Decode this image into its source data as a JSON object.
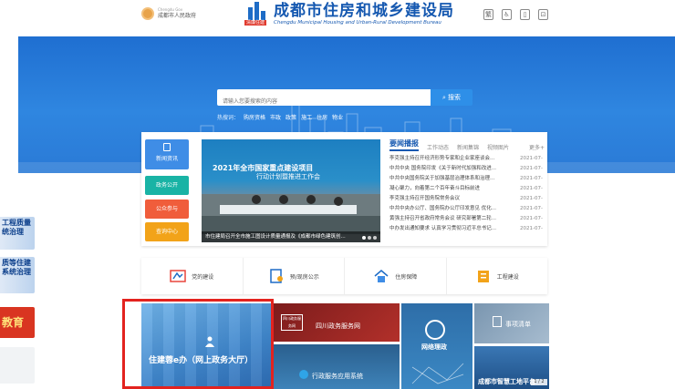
{
  "header": {
    "gov_logo_en": "Chengdu Gov",
    "gov_logo_cn": "成都市人民政府",
    "logo_tag": "清廉住建",
    "title": "成都市住房和城乡建设局",
    "subtitle": "Chengdu Municipal Housing and Urban-Rural Development Bureau",
    "tools": [
      {
        "icon": "traditional-chinese-icon",
        "glyph": "繁"
      },
      {
        "icon": "accessibility-icon",
        "glyph": "♿"
      },
      {
        "icon": "mobile-icon",
        "glyph": "▯"
      },
      {
        "icon": "wechat-icon",
        "glyph": "⊡"
      }
    ]
  },
  "search": {
    "placeholder": "请输入您要搜索的内容",
    "button_label": "搜索",
    "hot_label": "热搜词：",
    "hot_words": [
      "购房资格",
      "市政",
      "政策",
      "施工",
      "住房",
      "物业"
    ]
  },
  "side_promos": [
    {
      "text": "工程质量\n统治理"
    },
    {
      "text": "质等住建\n系统治理"
    },
    {
      "text": "教育"
    },
    {
      "text": ""
    }
  ],
  "quick_nav": [
    {
      "label": "新闻资讯",
      "color": "#3f8de6"
    },
    {
      "label": "政务公开",
      "color": "#19b3a5"
    },
    {
      "label": "公众参与",
      "color": "#f05d3b"
    },
    {
      "label": "查询中心",
      "color": "#f2a319"
    }
  ],
  "carousel": {
    "banner_line1": "2021年全市国家重点建设项目",
    "banner_line2": "行动计划暨推进工作会",
    "caption": "市住建局召开全市施工图设计质量通报及《成都市绿色建筑创..."
  },
  "news": {
    "tabs": [
      {
        "label": "要闻播报",
        "active": true
      },
      {
        "label": "工作动态",
        "active": false
      },
      {
        "label": "新闻集锦",
        "active": false
      },
      {
        "label": "视频图片",
        "active": false
      }
    ],
    "more": "更多+",
    "items": [
      {
        "title": "李克强主持召开经济形势专家和企业家座谈会...",
        "date": "2021-07-"
      },
      {
        "title": "中共中央 国务院印发《关于新时代加强和改进...",
        "date": "2021-07-"
      },
      {
        "title": "中共中央国务院关于加强基层治理体系和治理...",
        "date": "2021-07-"
      },
      {
        "title": "凝心聚力，向着第二个百年奋斗目标前进",
        "date": "2021-07-"
      },
      {
        "title": "李克强主持召开国务院常务会议",
        "date": "2021-07-"
      },
      {
        "title": "中共中央办公厅、国务院办公厅印发意见 优化...",
        "date": "2021-07-"
      },
      {
        "title": "黄强主持召开省政府常务会议 研究部署第二轮...",
        "date": "2021-07-"
      },
      {
        "title": "中办发出通知要求 认真学习贯彻习近平总书记...",
        "date": "2021-07-"
      }
    ]
  },
  "services": [
    {
      "label": "党的建设",
      "icon": "party-building-icon"
    },
    {
      "label": "预/现房公示",
      "icon": "house-notice-icon"
    },
    {
      "label": "住房保障",
      "icon": "housing-security-icon"
    },
    {
      "label": "工程建设",
      "icon": "construction-icon"
    }
  ],
  "tiles": {
    "main": "住建蓉e办（网上政务大厅）",
    "sichuan": "四川政务服务网",
    "sichuan_badge": "四川政务服务网",
    "admin_app": "行政服务应用系统",
    "net_supervision": "网络理政",
    "matters": "事项清单",
    "smart_site": "成都市智慧工地平台",
    "pager": "1 / 2"
  },
  "colors": {
    "brand_blue": "#1558b0",
    "hero_blue": "#2a7ad6",
    "highlight_red": "#e3231f"
  }
}
